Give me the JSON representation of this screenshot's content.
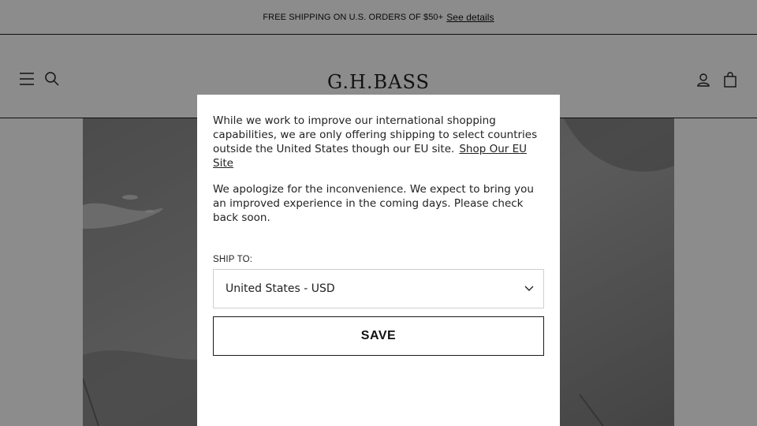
{
  "promo": {
    "text": "FREE SHIPPING ON U.S. ORDERS OF $50+",
    "link": "See details"
  },
  "header": {
    "logo": "G.H.BASS",
    "icons": [
      "menu-icon",
      "search-icon",
      "account-icon",
      "bag-icon"
    ]
  },
  "modal": {
    "paragraph1": "While we work to improve our international shopping capabilities, we are only offering shipping to select countries outside the United States though our EU site.",
    "eu_link": "Shop Our EU Site",
    "paragraph2": "We apologize for the inconvenience.  We expect to bring you an improved experience in the coming days.  Please check back soon.",
    "ship_to_label": "SHIP TO:",
    "selected_country": "United States - USD",
    "save_label": "SAVE"
  },
  "colors": {
    "overlay": "rgba(0,0,0,0.45)",
    "border": "#1a1a1a"
  }
}
